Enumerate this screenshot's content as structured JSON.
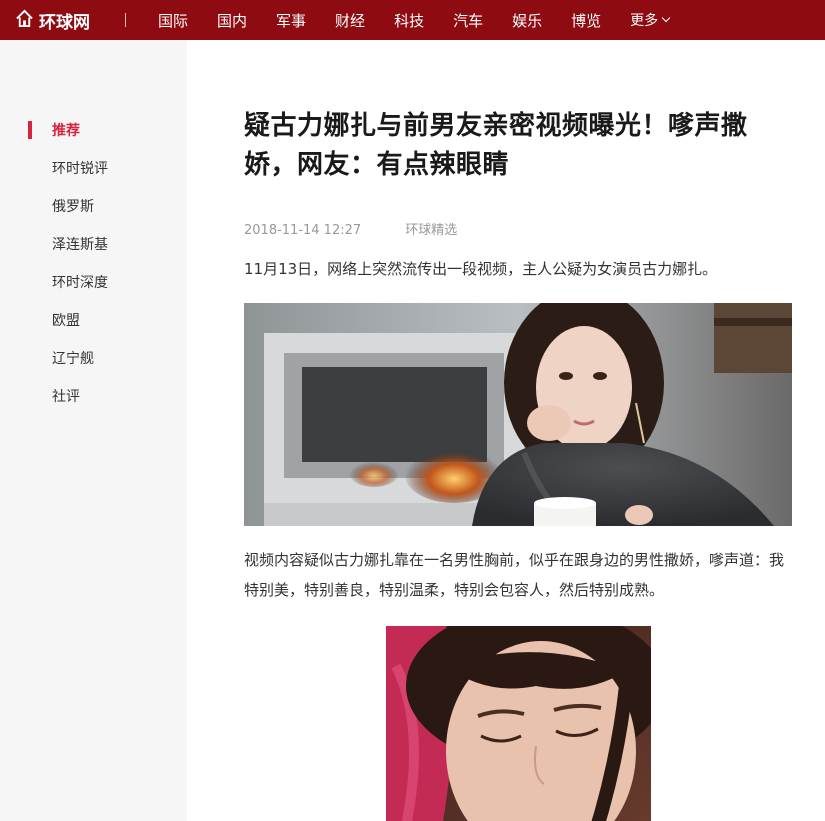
{
  "header": {
    "logo_text": "环球网",
    "nav_items": [
      "国际",
      "国内",
      "军事",
      "财经",
      "科技",
      "汽车",
      "娱乐",
      "博览"
    ],
    "more_label": "更多"
  },
  "sidebar": {
    "items": [
      {
        "label": "推荐",
        "active": true
      },
      {
        "label": "环时锐评",
        "active": false
      },
      {
        "label": "俄罗斯",
        "active": false
      },
      {
        "label": "泽连斯基",
        "active": false
      },
      {
        "label": "环时深度",
        "active": false
      },
      {
        "label": "欧盟",
        "active": false
      },
      {
        "label": "辽宁舰",
        "active": false
      },
      {
        "label": "社评",
        "active": false
      }
    ]
  },
  "article": {
    "title": "疑古力娜扎与前男友亲密视频曝光！嗲声撒娇，网友：有点辣眼睛",
    "date": "2018-11-14 12:27",
    "source": "环球精选",
    "paragraph1": "11月13日，网络上突然流传出一段视频，主人公疑为女演员古力娜扎。",
    "paragraph2": "视频内容疑似古力娜扎靠在一名男性胸前，似乎在跟身边的男性撒娇，嗲声道：我特别美，特别善良，特别温柔，特别会包容人，然后特别成熟。"
  },
  "colors": {
    "header_bg": "#8e0c11",
    "accent": "#d7243e",
    "sidebar_bg": "#f6f6f6"
  }
}
